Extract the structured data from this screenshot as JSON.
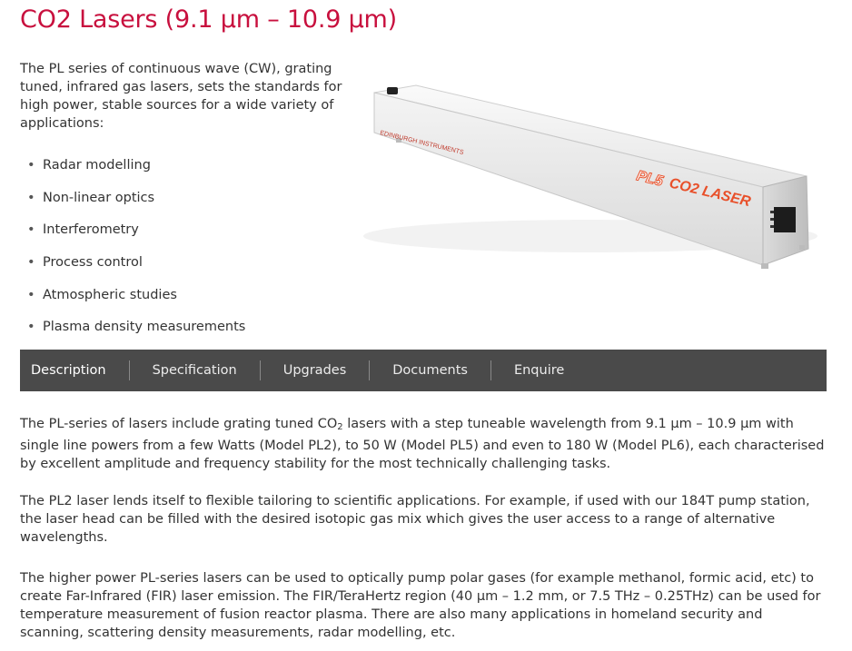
{
  "page": {
    "title": "CO2 Lasers (9.1 µm – 10.9 µm)",
    "intro": "The PL series of continuous wave (CW), grating tuned, infrared gas lasers, sets the standards for high power, stable sources for a wide variety of applications:",
    "features": [
      "Radar modelling",
      "Non-linear optics",
      "Interferometry",
      "Process control",
      "Atmospheric studies",
      "Plasma density measurements"
    ]
  },
  "product_image": {
    "brand_text": "EDINBURGH INSTRUMENTS",
    "model_text": "PL5",
    "logo_text": "CO2 LASER"
  },
  "tabs": [
    {
      "label": "Description",
      "active": true
    },
    {
      "label": "Specification",
      "active": false
    },
    {
      "label": "Upgrades",
      "active": false
    },
    {
      "label": "Documents",
      "active": false
    },
    {
      "label": "Enquire",
      "active": false
    }
  ],
  "description": {
    "p1_a": "The PL-series of lasers include grating tuned CO",
    "p1_sub": "2",
    "p1_b": " lasers with a step tuneable wavelength from 9.1 µm – 10.9 µm with single line powers from a few Watts (Model PL2), to 50 W (Model PL5) and even to 180 W (Model PL6), each characterised by excellent amplitude and frequency stability for the most technically challenging tasks.",
    "p2": "The PL2 laser lends itself to flexible tailoring to scientific applications. For example, if used with our 184T pump station, the laser head can be filled with the desired isotopic gas mix which gives the user access to a range of alternative wavelengths.",
    "p3": "The higher power PL-series lasers can be used to optically pump polar gases (for example methanol, formic acid, etc) to create Far-Infrared (FIR) laser emission. The FIR/TeraHertz region (40 µm – 1.2 mm, or 7.5 THz – 0.25THz) can be used for temperature measurement of fusion reactor plasma. There are also many applications in homeland security and scanning, scattering density measurements, radar modelling, etc."
  },
  "colors": {
    "title": "#c8103e",
    "tab_bar": "#4a4a4a",
    "logo_orange": "#e8502a"
  }
}
